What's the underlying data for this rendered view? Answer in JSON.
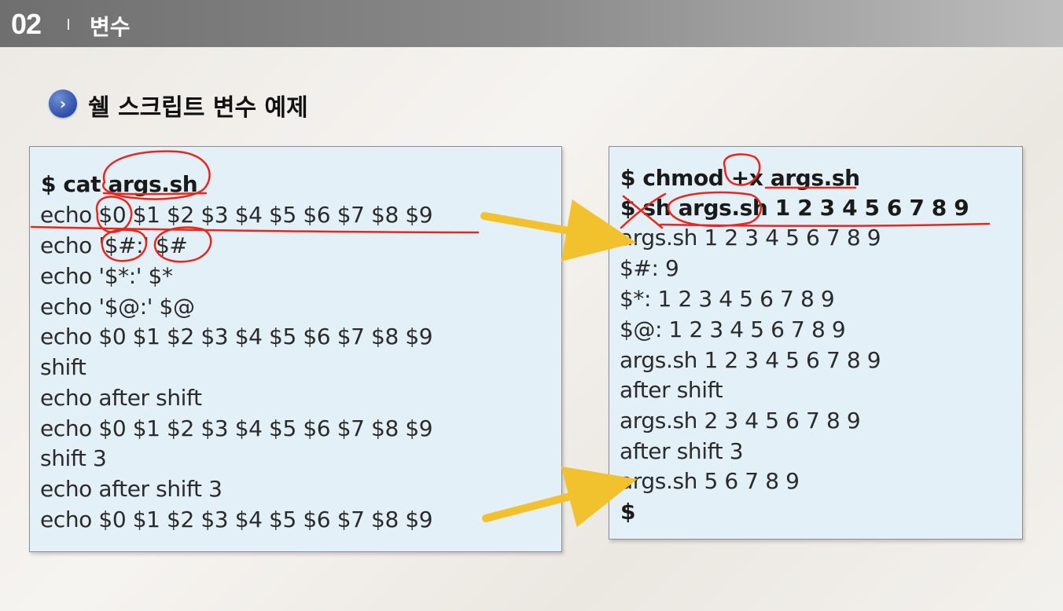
{
  "header": {
    "section_number": "02",
    "section_title": "변수"
  },
  "slide": {
    "bullet_glyph": "›",
    "title": "쉘 스크립트 변수 예제"
  },
  "script_listing": {
    "lines": [
      "$ cat args.sh",
      "echo $0 $1 $2 $3 $4 $5 $6 $7 $8 $9",
      "echo '$#:' $#",
      "echo '$*:' $*",
      "echo '$@:' $@",
      "echo $0 $1 $2 $3 $4 $5 $6 $7 $8 $9",
      "shift",
      "echo after shift",
      "echo $0 $1 $2 $3 $4 $5 $6 $7 $8 $9",
      "shift 3",
      "echo after shift 3",
      "echo $0 $1 $2 $3 $4 $5 $6 $7 $8 $9"
    ]
  },
  "terminal_output": {
    "lines": [
      "$ chmod +x args.sh",
      "$ sh args.sh 1 2 3 4 5 6 7 8 9",
      "args.sh 1 2 3 4 5 6 7 8 9",
      "$#: 9",
      "$*: 1 2 3 4 5 6 7 8 9",
      "$@: 1 2 3 4 5 6 7 8 9",
      "args.sh 1 2 3 4 5 6 7 8 9",
      "after shift",
      "args.sh 2 3 4 5 6 7 8 9",
      "after shift 3",
      "args.sh 5 6 7 8 9",
      "$"
    ]
  },
  "colors": {
    "annotation_ink": "#e8261c",
    "arrow": "#f2c22e",
    "code_box_bg": "#e3f0f8"
  }
}
